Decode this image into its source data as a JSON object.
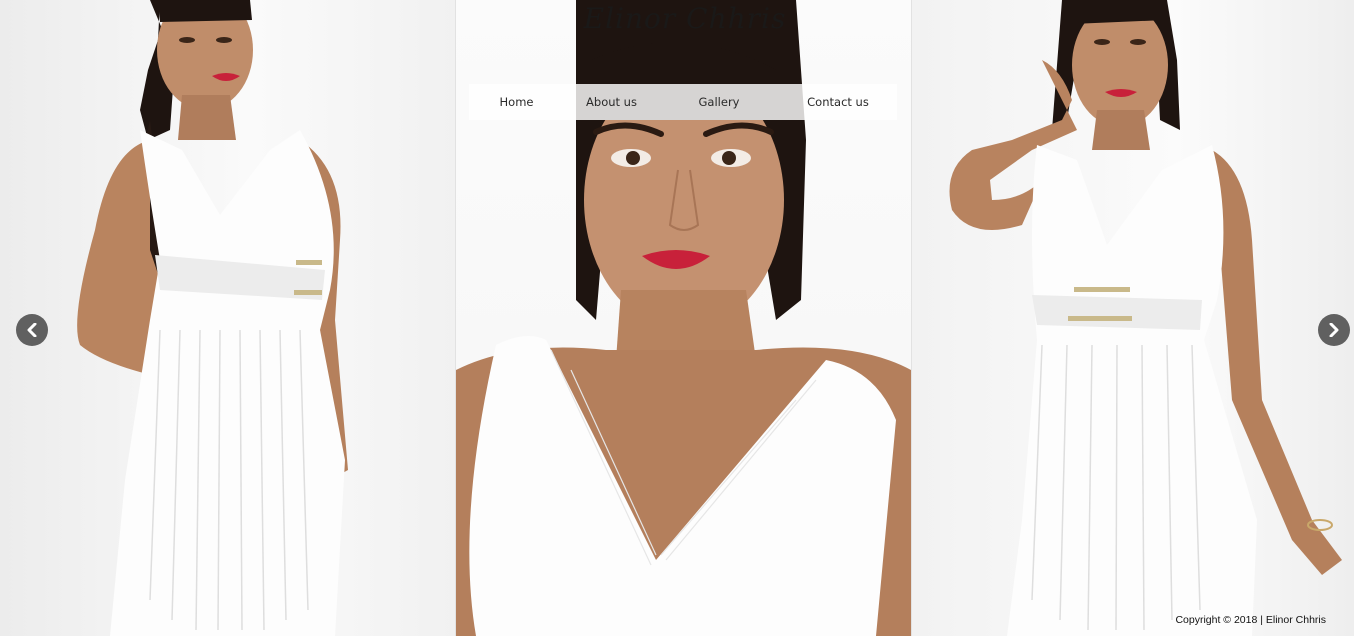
{
  "site": {
    "title": "Elinor Chhris"
  },
  "nav": {
    "items": [
      {
        "label": "Home"
      },
      {
        "label": "About us"
      },
      {
        "label": "Gallery"
      },
      {
        "label": "Contact us"
      }
    ]
  },
  "carousel": {
    "prev_icon": "chevron-left-icon",
    "next_icon": "chevron-right-icon"
  },
  "footer": {
    "copyright": "Copyright © 2018 | Elinor Chhris"
  },
  "colors": {
    "arrow_bg": "#464646",
    "lips": "#c8213a",
    "skin": "#b8825f",
    "hair": "#1e1410",
    "dress": "#ffffff"
  }
}
